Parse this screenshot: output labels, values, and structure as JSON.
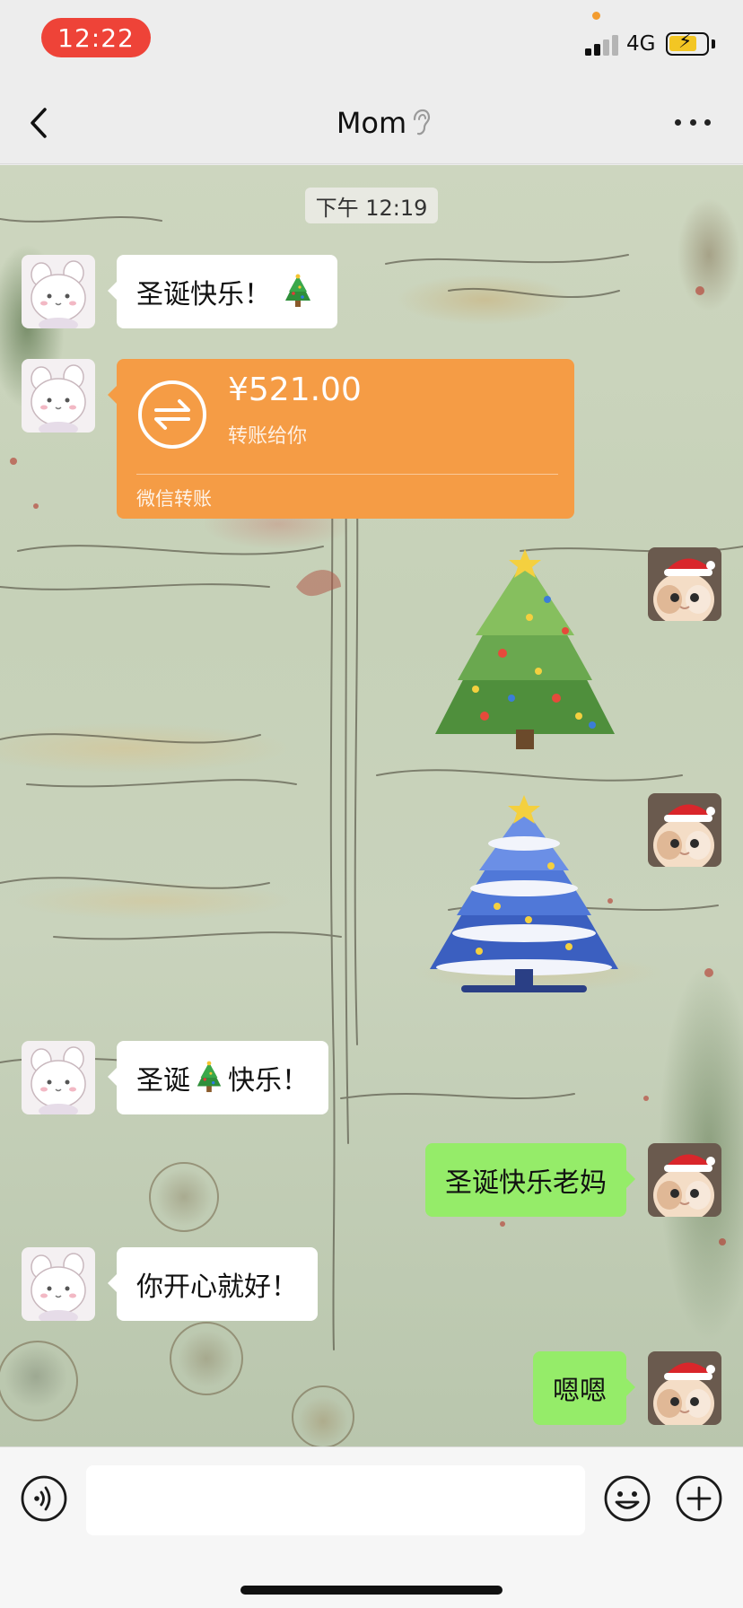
{
  "status_bar": {
    "time": "12:22",
    "network": "4G",
    "colors": {
      "time_pill": "#ee4338",
      "battery": "#f3c623"
    }
  },
  "nav": {
    "title": "Mom",
    "icons": [
      "back-chevron-icon",
      "ear-icon",
      "more-icon"
    ]
  },
  "chat": {
    "timestamp": "下午 12:19",
    "messages": [
      {
        "side": "left",
        "type": "text",
        "text": "圣诞快乐！",
        "emoji": "christmas-tree-icon"
      },
      {
        "side": "left",
        "type": "transfer",
        "amount": "¥521.00",
        "note": "转账给你",
        "label": "微信转账"
      },
      {
        "side": "right",
        "type": "sticker",
        "sticker": "green-christmas-tree-sticker"
      },
      {
        "side": "right",
        "type": "sticker",
        "sticker": "blue-christmas-tree-sticker"
      },
      {
        "side": "left",
        "type": "text",
        "text_before": "圣诞",
        "emoji": "christmas-tree-icon",
        "text_after": "快乐！"
      },
      {
        "side": "right",
        "type": "text",
        "text": "圣诞快乐老妈"
      },
      {
        "side": "left",
        "type": "text",
        "text": "你开心就好！"
      },
      {
        "side": "right",
        "type": "text",
        "text": "嗯嗯"
      }
    ],
    "colors": {
      "self_bubble": "#95ec69",
      "other_bubble": "#ffffff",
      "transfer_card": "#f59c45"
    }
  },
  "input_bar": {
    "placeholder": "",
    "icons": [
      "voice-icon",
      "emoji-icon",
      "plus-icon"
    ]
  }
}
